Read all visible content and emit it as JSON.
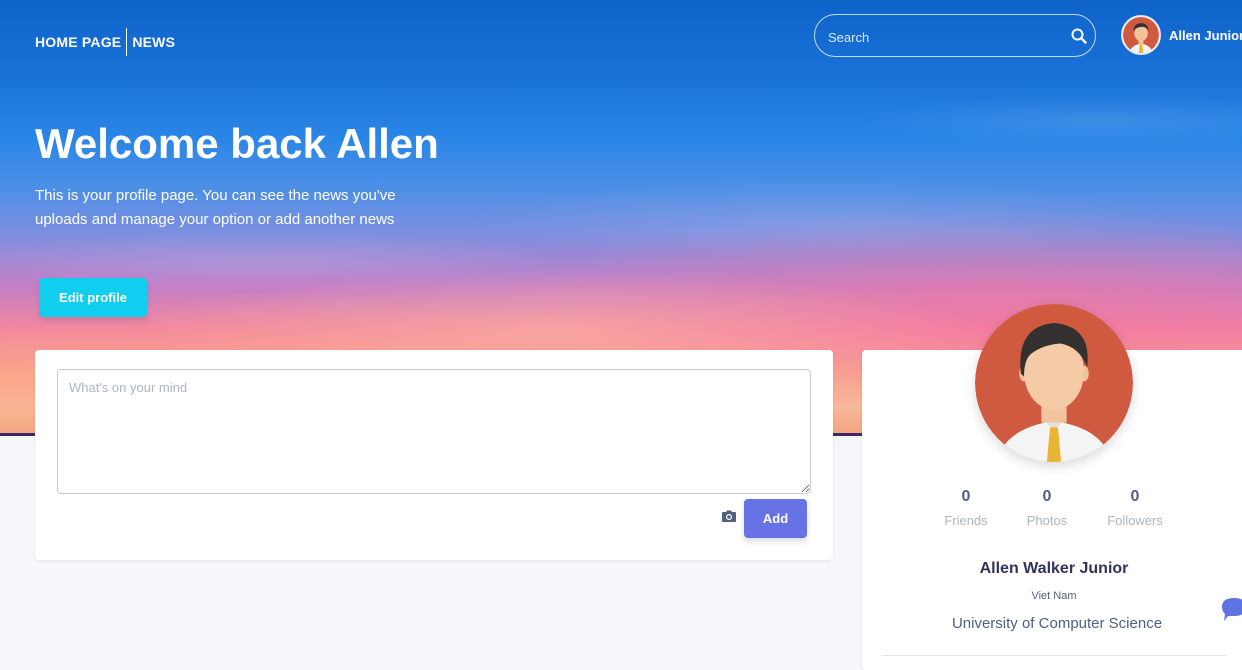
{
  "nav": {
    "links": [
      "HOME PAGE",
      "NEWS"
    ],
    "search_placeholder": "Search",
    "user_name": "Allen Junior"
  },
  "hero": {
    "title": "Welcome back Allen",
    "description": "This is your profile page. You can see the news you've uploads and manage your option or add another news",
    "edit_label": "Edit profile"
  },
  "post": {
    "placeholder": "What's on your mind",
    "add_label": "Add"
  },
  "profile": {
    "stats": [
      {
        "value": "0",
        "label": "Friends"
      },
      {
        "value": "0",
        "label": "Photos"
      },
      {
        "value": "0",
        "label": "Followers"
      }
    ],
    "name": "Allen Walker Junior",
    "country": "Viet Nam",
    "school": "University of Computer Science"
  },
  "colors": {
    "edit_button": "#11cdef",
    "add_button": "#6772e5",
    "avatar_bg": "#cf5a3f"
  },
  "icons": [
    "search-icon",
    "camera-icon",
    "chat-icon"
  ]
}
